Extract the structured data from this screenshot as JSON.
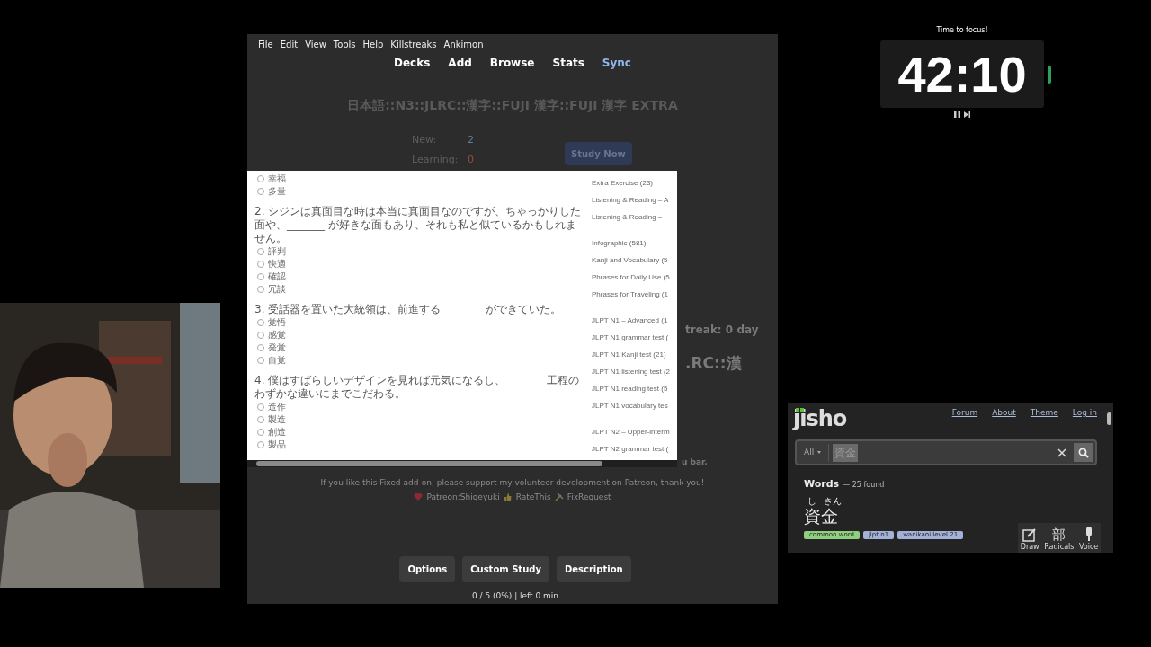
{
  "anki": {
    "menu": [
      "File",
      "Edit",
      "View",
      "Tools",
      "Help",
      "Killstreaks",
      "Ankimon"
    ],
    "toolbar": [
      {
        "label": "Decks",
        "accent": false
      },
      {
        "label": "Add",
        "accent": false
      },
      {
        "label": "Browse",
        "accent": false
      },
      {
        "label": "Stats",
        "accent": false
      },
      {
        "label": "Sync",
        "accent": true
      }
    ],
    "deck_title": "日本語::N3::JLRC::漢字::FUJI 漢字::FUJI 漢字 EXTRA",
    "counts": [
      {
        "label": "New:",
        "value": "2",
        "color": "#5b7f9e"
      },
      {
        "label": "Learning:",
        "value": "0",
        "color": "#9a4a3e"
      }
    ],
    "study_button": "Study Now",
    "behind_texts": [
      "treak: 0 day",
      ".RC::漢",
      "u bar."
    ],
    "popup": {
      "questions": [
        {
          "options": [
            {
              "label": "幸福",
              "selected": false
            },
            {
              "label": "多量",
              "selected": false
            }
          ]
        },
        {
          "text": "2. シジンは真面目な時は本当に真面目なのですが、ちゃっかりした面や、_______ が好きな面もあり、それも私と似ているかもしれません。",
          "options": [
            {
              "label": "評判",
              "selected": false
            },
            {
              "label": "快適",
              "selected": false
            },
            {
              "label": "確認",
              "selected": false
            },
            {
              "label": "冗談",
              "selected": false
            }
          ]
        },
        {
          "text": "3. 受話器を置いた大統領は、前進する _______ ができていた。",
          "options": [
            {
              "label": "覚悟",
              "selected": false
            },
            {
              "label": "感覚",
              "selected": false
            },
            {
              "label": "発覚",
              "selected": false
            },
            {
              "label": "自覚",
              "selected": false
            }
          ]
        },
        {
          "text": "4. 僕はすばらしいデザインを見れば元気になるし、_______ 工程のわずかな違いにまでこだわる。",
          "options": [
            {
              "label": "造作",
              "selected": false
            },
            {
              "label": "製造",
              "selected": false
            },
            {
              "label": "創造",
              "selected": false
            },
            {
              "label": "製品",
              "selected": false
            }
          ]
        }
      ],
      "link_groups": [
        [
          "Extra Exercise (23)",
          "Listening & Reading – A",
          "Listening & Reading – I"
        ],
        [
          "Infographic (581)",
          "Kanji and Vocabulary (5",
          "Phrases for Daily Use (5",
          "Phrases for Traveling (1"
        ],
        [
          "JLPT N1 – Advanced (1",
          "JLPT N1 grammar test (",
          "JLPT N1 Kanji test (21)",
          "JLPT N1 listening test (2",
          "JLPT N1 reading test (5",
          "JLPT N1 vocabulary tes"
        ],
        [
          "JLPT N2 – Upper-interm",
          "JLPT N2 grammar test ("
        ]
      ]
    },
    "support_text": "If you like this Fixed add-on, please support my volunteer development on Patreon, thank you!",
    "support_links": [
      {
        "kind": "heart",
        "label": "Patreon:Shigeyuki"
      },
      {
        "kind": "thumb",
        "label": "RateThis"
      },
      {
        "kind": "tools",
        "label": "FixRequest"
      }
    ],
    "buttons": [
      "Options",
      "Custom Study",
      "Description"
    ],
    "progress": "0 / 5 (0%) | left 0 min"
  },
  "timer": {
    "caption": "Time to focus!",
    "time": "42:10"
  },
  "jisho": {
    "logo": "jisho",
    "links": [
      "Forum",
      "About",
      "Theme",
      "Log in"
    ],
    "filter": "All",
    "query": "資金",
    "heading": "Words",
    "found": "— 25 found",
    "furigana": [
      "し",
      "さん"
    ],
    "word": "資金",
    "tags": [
      {
        "label": "common word",
        "color": "#8fcf7f"
      },
      {
        "label": "jlpt n1",
        "color": "#a3b1d8"
      },
      {
        "label": "wanikani level 21",
        "color": "#a3b1d8"
      }
    ],
    "tools": [
      {
        "kind": "draw",
        "label": "Draw"
      },
      {
        "kind": "radicals",
        "label": "Radicals",
        "glyph": "部"
      },
      {
        "kind": "voice",
        "label": "Voice"
      }
    ]
  }
}
